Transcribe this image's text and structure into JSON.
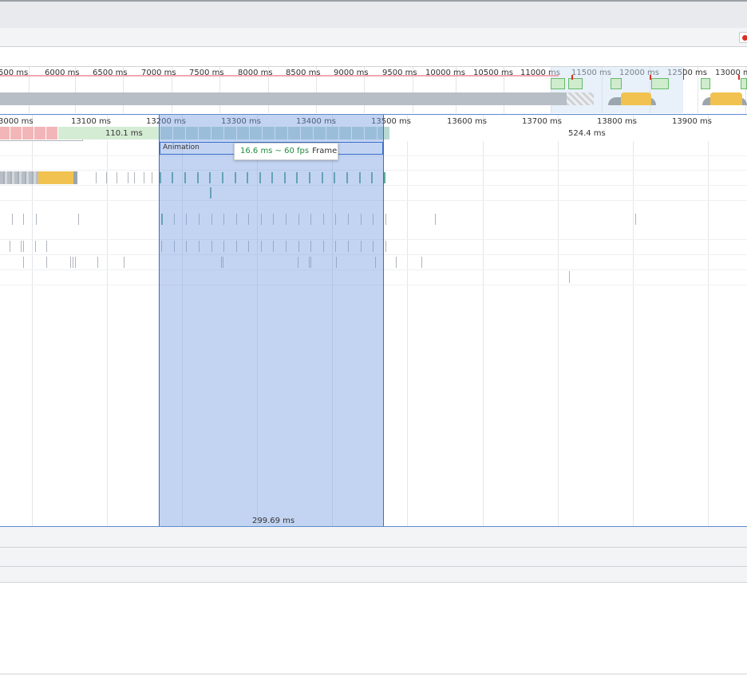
{
  "overview": {
    "ruler_labels": [
      "500 ms",
      "6000 ms",
      "6500 ms",
      "7000 ms",
      "7500 ms",
      "8000 ms",
      "8500 ms",
      "9000 ms",
      "9500 ms",
      "10000 ms",
      "10500 ms",
      "11000 ms",
      "11500 ms",
      "12000 ms",
      "12500 ms",
      "13000 ms"
    ],
    "fps_color": "#f0a8b0",
    "cpu_color": "#b8bec6",
    "scripting_color": "#f1c24f",
    "rendering_color": "#66bb6a"
  },
  "main": {
    "ruler_labels": [
      "3000 ms",
      "13100 ms",
      "13200 ms",
      "13300 ms",
      "13400 ms",
      "13500 ms",
      "13600 ms",
      "13700 ms",
      "13800 ms",
      "13900 ms"
    ],
    "frames": {
      "frame_a_label": "110.1 ms",
      "frame_b_label": "524.4 ms"
    },
    "animation_label": "Animation",
    "selection_duration": "299.69 ms",
    "selection_color": "#7199e0"
  },
  "tooltip": {
    "fps_text": "16.6 ms ~ 60 fps",
    "kind_text": "Frame"
  }
}
